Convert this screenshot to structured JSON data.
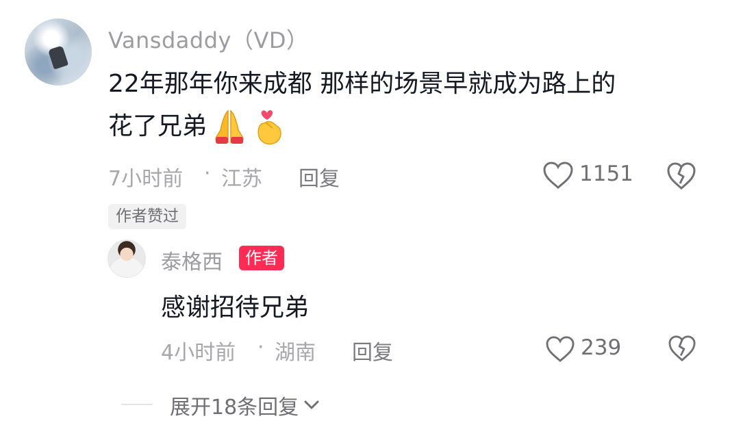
{
  "comment": {
    "username": "Vansdaddy（VD）",
    "text_line1": "22年那年你来成都 那样的场景早就成为路上的",
    "text_line2": "花了兄弟",
    "time": "7小时前",
    "sep": "·",
    "location": "江苏",
    "reply_label": "回复",
    "like_count": "1151",
    "author_liked_badge": "作者赞过",
    "icons": [
      "folded-hands-emoji",
      "finger-heart-emoji",
      "heart-outline-icon",
      "broken-heart-icon"
    ]
  },
  "reply": {
    "username": "泰格西",
    "author_tag": "作者",
    "text": "感谢招待兄弟",
    "time": "4小时前",
    "sep": "·",
    "location": "湖南",
    "reply_label": "回复",
    "like_count": "239"
  },
  "expand": {
    "label": "展开18条回复",
    "icon": "chevron-down-icon"
  },
  "colors": {
    "text_primary": "#161823",
    "text_secondary": "#9b9ba0",
    "author_tag_bg": "#fe2c55"
  }
}
